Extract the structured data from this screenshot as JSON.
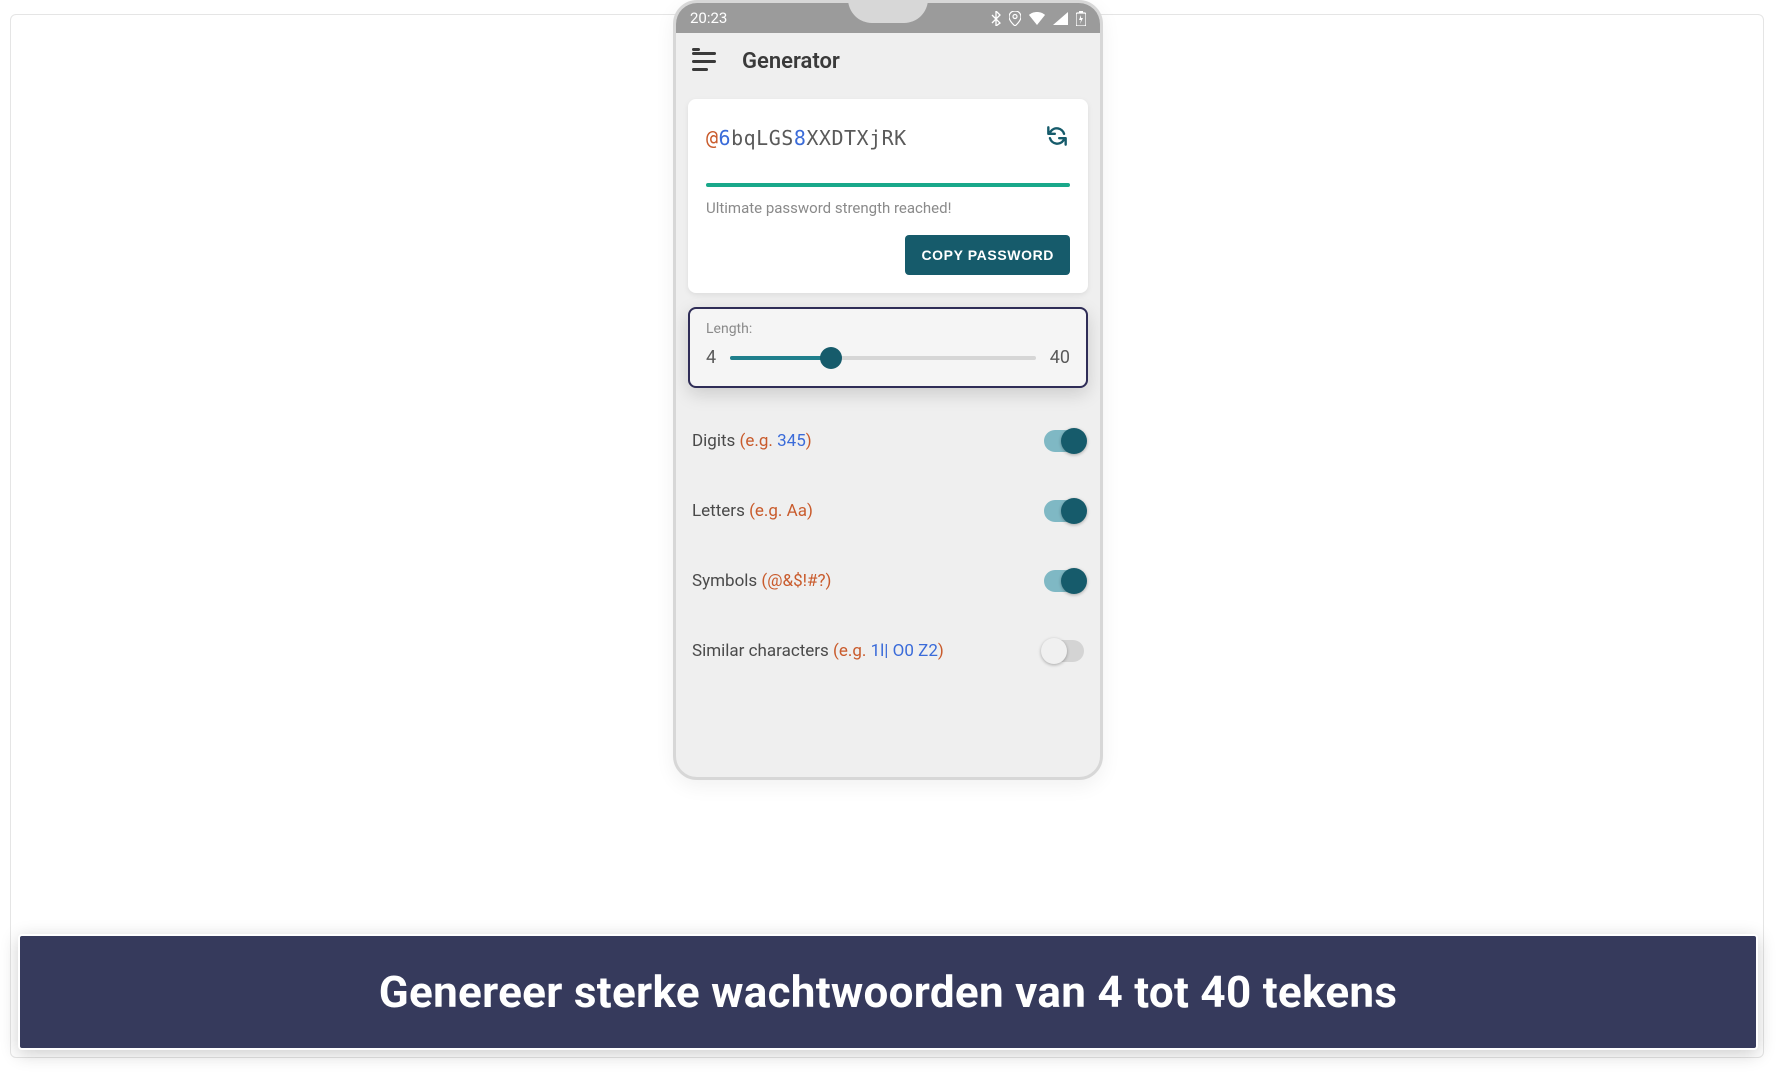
{
  "statusbar": {
    "time": "20:23"
  },
  "header": {
    "title": "Generator"
  },
  "password": {
    "segments": [
      {
        "text": "@",
        "cls": "sym"
      },
      {
        "text": "6",
        "cls": "dig"
      },
      {
        "text": "bqLGS",
        "cls": "ltr"
      },
      {
        "text": "8",
        "cls": "dig"
      },
      {
        "text": "XXDTXjRK",
        "cls": "ltr"
      }
    ],
    "strength_text": "Ultimate password strength reached!",
    "copy_label": "COPY PASSWORD"
  },
  "length": {
    "label": "Length:",
    "min": "4",
    "max": "40"
  },
  "options": {
    "digits": {
      "label_pre": "Digits ",
      "eg_open": "(e.g. ",
      "eg_val": "345",
      "eg_close": ")",
      "on": true
    },
    "letters": {
      "label_pre": "Letters ",
      "eg_open": "(e.g. ",
      "eg_val": "Aa",
      "eg_close": ")",
      "on": true
    },
    "symbols": {
      "label_pre": "Symbols ",
      "eg_open": "(",
      "eg_val": "@&$!#?",
      "eg_close": ")",
      "on": true
    },
    "similar": {
      "label_pre": "Similar characters ",
      "eg_open": "(e.g. ",
      "eg_val": "1l| O0 Z2",
      "eg_close": ")",
      "on": false
    }
  },
  "caption": "Genereer sterke wachtwoorden van 4 tot 40 tekens"
}
